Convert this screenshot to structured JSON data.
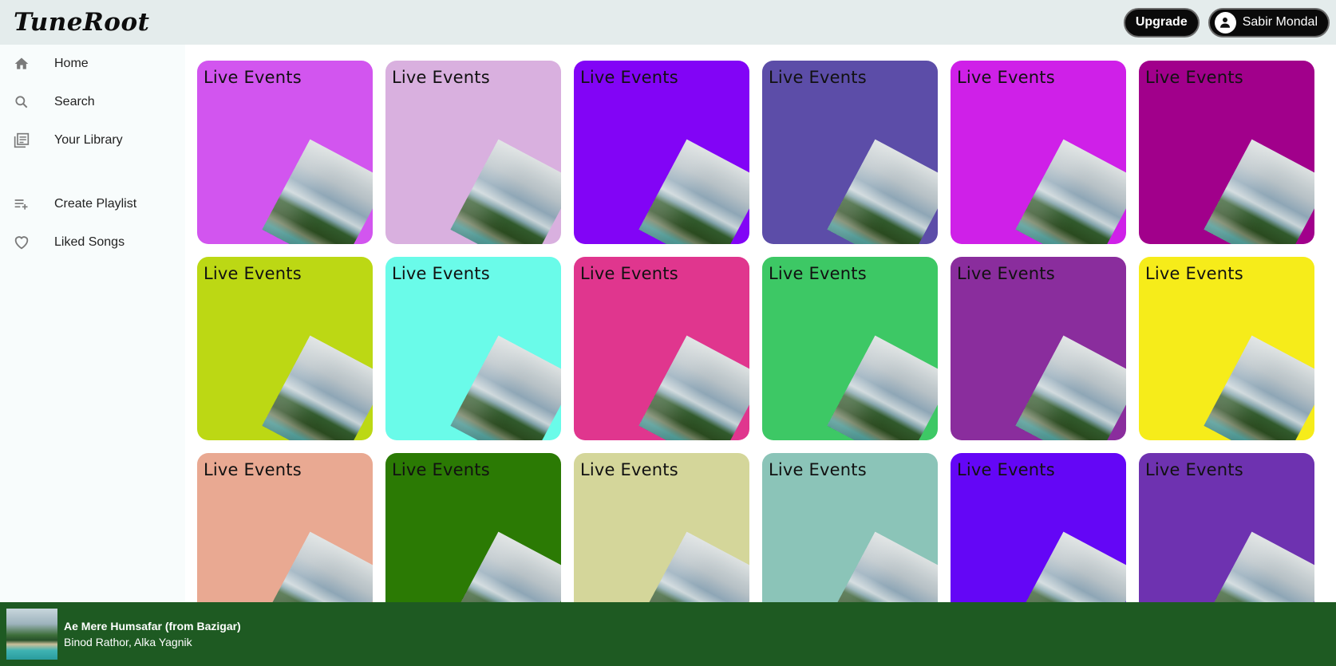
{
  "app": {
    "logo": "TuneRoot"
  },
  "header": {
    "upgrade_label": "Upgrade",
    "user_name": "Sabir Mondal"
  },
  "sidebar": {
    "items": [
      {
        "label": "Home",
        "icon": "home-icon"
      },
      {
        "label": "Search",
        "icon": "search-icon"
      },
      {
        "label": "Your Library",
        "icon": "library-icon"
      },
      {
        "label": "Create Playlist",
        "icon": "playlist-add-icon"
      },
      {
        "label": "Liked Songs",
        "icon": "heart-icon"
      }
    ]
  },
  "grid": {
    "partial_row_colors": [
      "#8d1b5c",
      "#73c490",
      "#e68a3a",
      "#8fc0ec",
      "#f0a98a",
      "#e83ad0"
    ],
    "cards": [
      {
        "title": "Live Events",
        "color": "#d255ef"
      },
      {
        "title": "Live Events",
        "color": "#d9b0df"
      },
      {
        "title": "Live Events",
        "color": "#8204f6"
      },
      {
        "title": "Live Events",
        "color": "#5c4da8"
      },
      {
        "title": "Live Events",
        "color": "#cf20e8"
      },
      {
        "title": "Live Events",
        "color": "#a1008b"
      },
      {
        "title": "Live Events",
        "color": "#bcd814"
      },
      {
        "title": "Live Events",
        "color": "#6afbe9"
      },
      {
        "title": "Live Events",
        "color": "#e0368e"
      },
      {
        "title": "Live Events",
        "color": "#3dc865"
      },
      {
        "title": "Live Events",
        "color": "#8a2d9d"
      },
      {
        "title": "Live Events",
        "color": "#f6ec1a"
      },
      {
        "title": "Live Events",
        "color": "#e9a992"
      },
      {
        "title": "Live Events",
        "color": "#2b7a04"
      },
      {
        "title": "Live Events",
        "color": "#d4d69a"
      },
      {
        "title": "Live Events",
        "color": "#8bc4b8"
      },
      {
        "title": "Live Events",
        "color": "#6406f6"
      },
      {
        "title": "Live Events",
        "color": "#6e32b0"
      }
    ]
  },
  "player": {
    "title": "Ae Mere Humsafar (from Bazigar)",
    "artists": "Binod Rathor, Alka Yagnik"
  }
}
